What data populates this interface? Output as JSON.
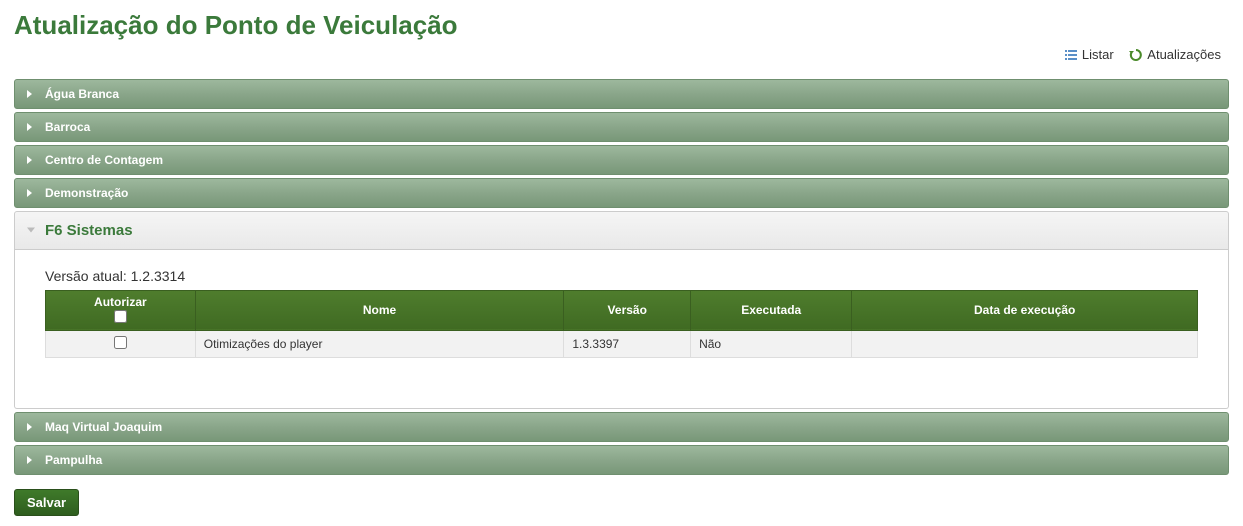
{
  "page": {
    "title": "Atualização do Ponto de Veiculação"
  },
  "toplinks": {
    "listar": "Listar",
    "atualizacoes": "Atualizações"
  },
  "panels": {
    "agua_branca": "Água Branca",
    "barroca": "Barroca",
    "centro_contagem": "Centro de Contagem",
    "demonstracao": "Demonstração",
    "f6_sistemas": "F6 Sistemas",
    "maq_virtual": "Maq Virtual Joaquim",
    "pampulha": "Pampulha"
  },
  "f6": {
    "version_label": "Versão atual: 1.2.3314",
    "headers": {
      "autorizar": "Autorizar",
      "nome": "Nome",
      "versao": "Versão",
      "executada": "Executada",
      "data_exec": "Data de execução"
    },
    "row": {
      "nome": "Otimizações do player",
      "versao": "1.3.3397",
      "executada": "Não",
      "data_exec": ""
    }
  },
  "actions": {
    "salvar": "Salvar"
  }
}
